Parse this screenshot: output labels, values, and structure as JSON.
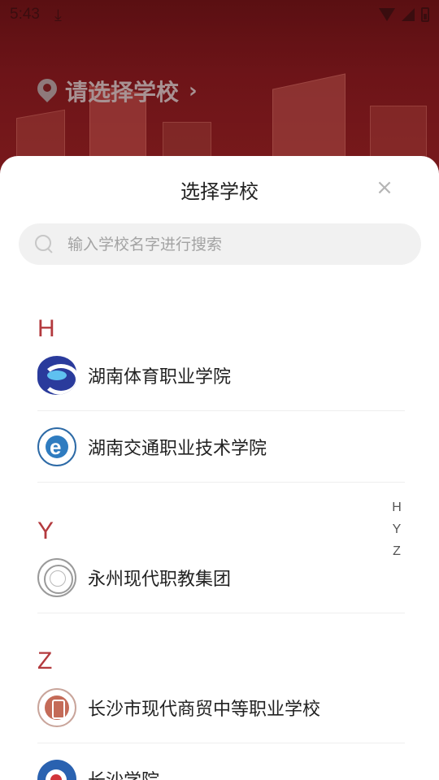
{
  "status_bar": {
    "time": "5:43"
  },
  "background": {
    "location_label": "请选择学校"
  },
  "modal": {
    "title": "选择学校",
    "close_symbol": "×",
    "search": {
      "placeholder": "输入学校名字进行搜索",
      "value": ""
    }
  },
  "sections": [
    {
      "letter": "H",
      "schools": [
        {
          "name": "湖南体育职业学院"
        },
        {
          "name": "湖南交通职业技术学院"
        }
      ]
    },
    {
      "letter": "Y",
      "schools": [
        {
          "name": "永州现代职教集团"
        }
      ]
    },
    {
      "letter": "Z",
      "schools": [
        {
          "name": "长沙市现代商贸中等职业学校"
        },
        {
          "name": "长沙学院"
        }
      ]
    }
  ],
  "index_bar": [
    "H",
    "Y",
    "Z"
  ],
  "colors": {
    "accent": "#b33a3e",
    "header_bg": "#6d1418"
  }
}
